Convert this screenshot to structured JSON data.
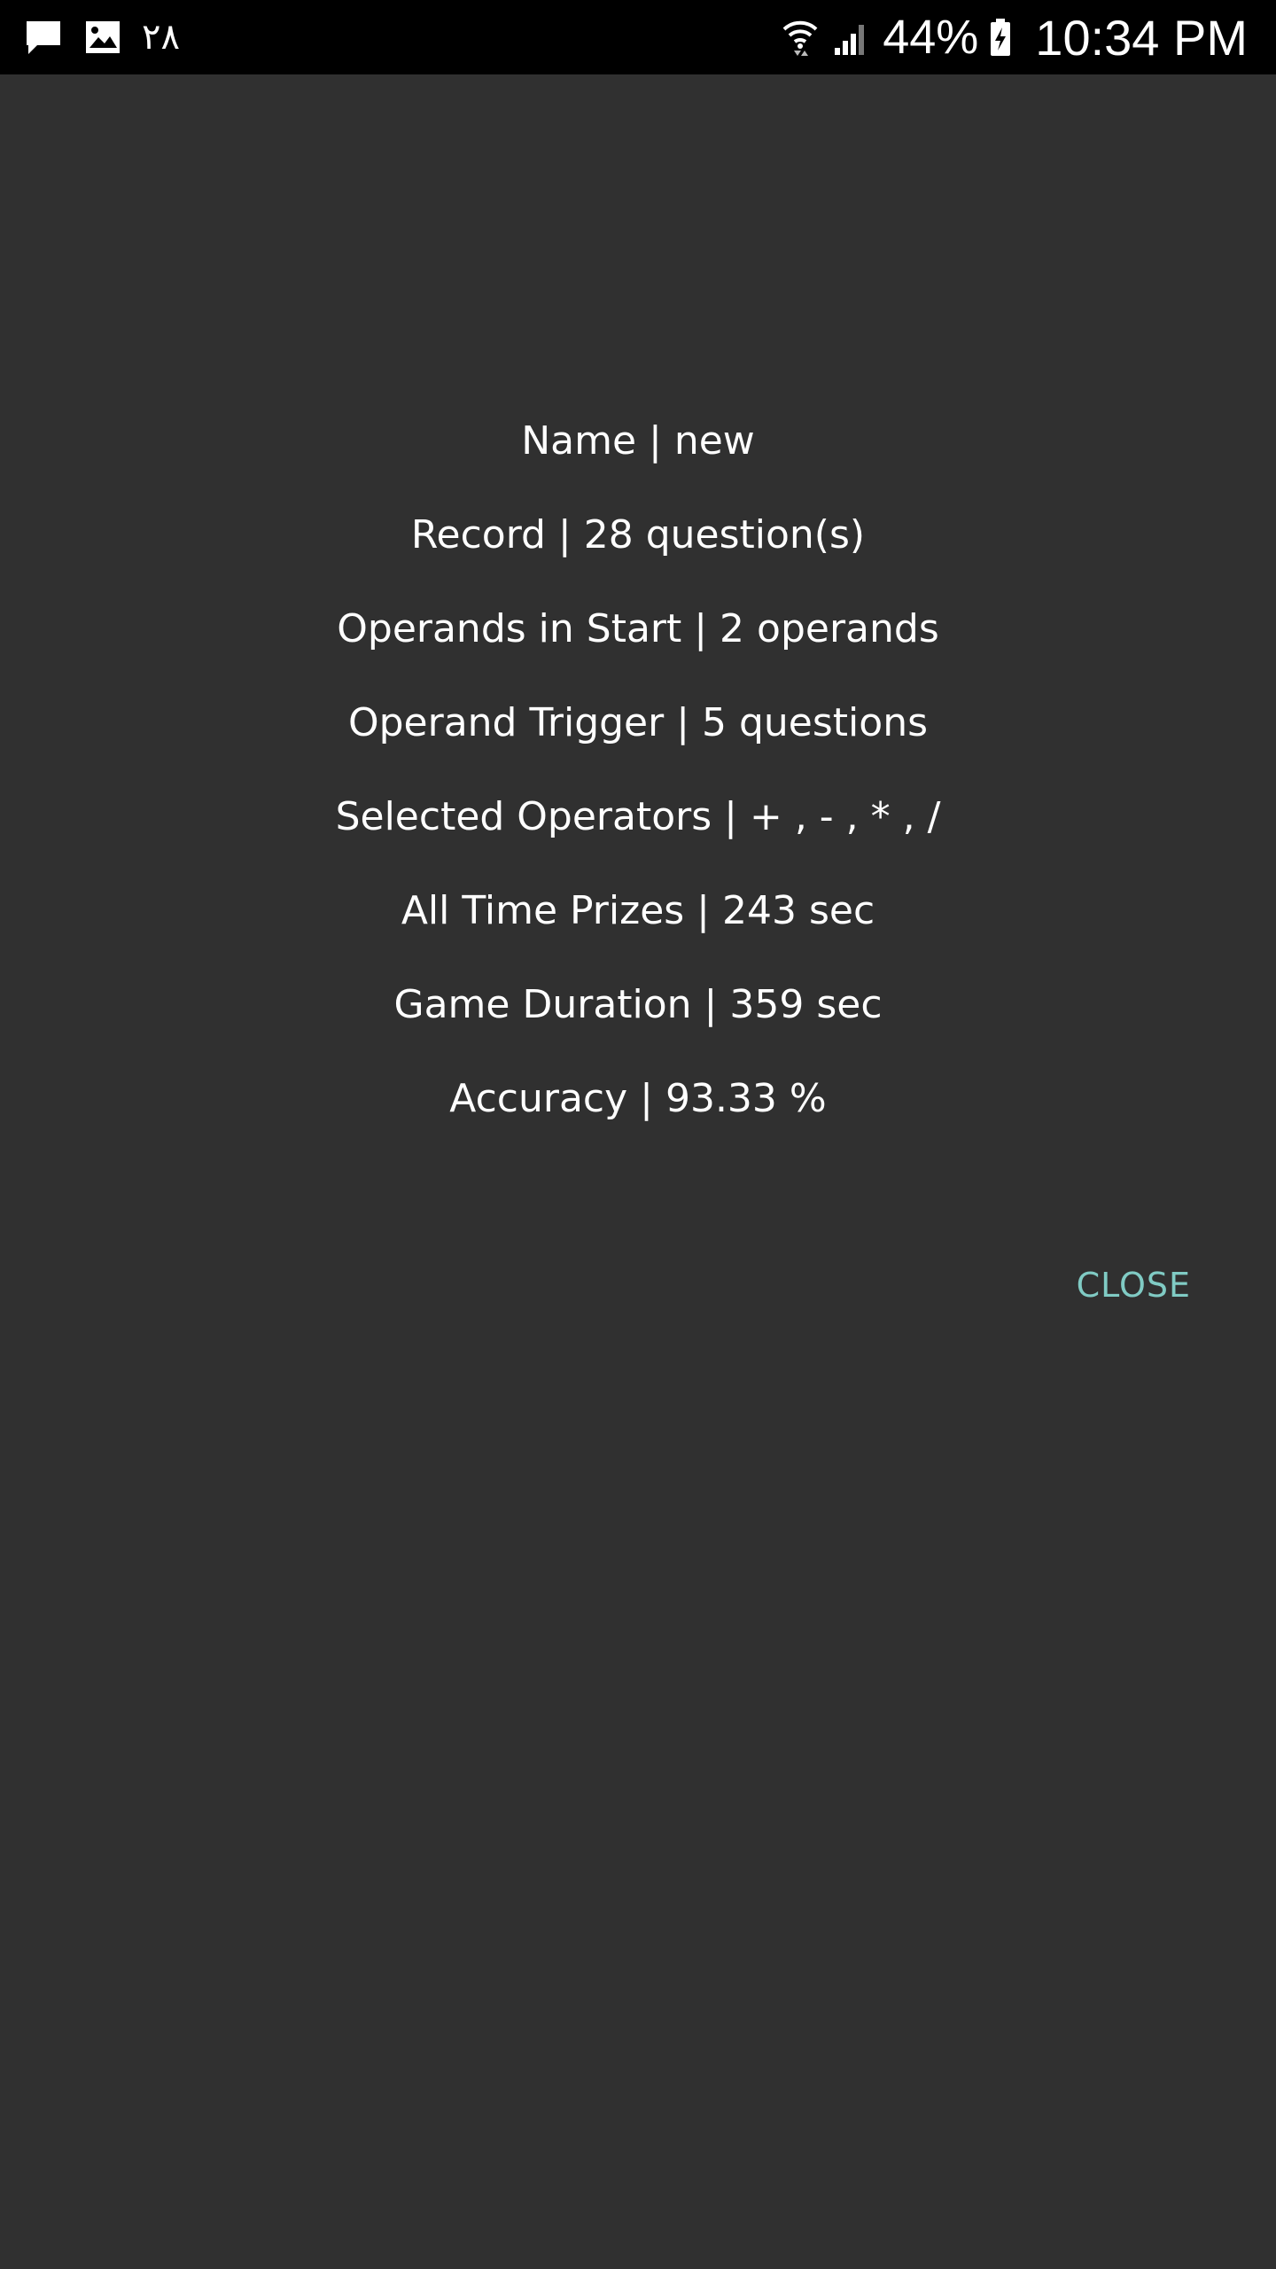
{
  "status_bar": {
    "left_icons": [
      "message-icon",
      "image-icon"
    ],
    "notification_count": "٢٨",
    "right_icons": [
      "wifi-icon",
      "signal-icon",
      "battery-charging-icon"
    ],
    "battery_percent": "44%",
    "time": "10:34 PM"
  },
  "stats": [
    {
      "text": "Name | new"
    },
    {
      "text": "Record | 28 question(s)"
    },
    {
      "text": "Operands in Start | 2 operands"
    },
    {
      "text": "Operand Trigger | 5 questions"
    },
    {
      "text": "Selected Operators | + , - , * , /"
    },
    {
      "text": "All Time Prizes | 243 sec"
    },
    {
      "text": "Game Duration | 359 sec"
    },
    {
      "text": "Accuracy | 93.33 %"
    }
  ],
  "dialog": {
    "close_label": "CLOSE"
  },
  "colors": {
    "background": "#303030",
    "status_bar": "#000000",
    "text": "#ffffff",
    "accent": "#80cbc4"
  }
}
